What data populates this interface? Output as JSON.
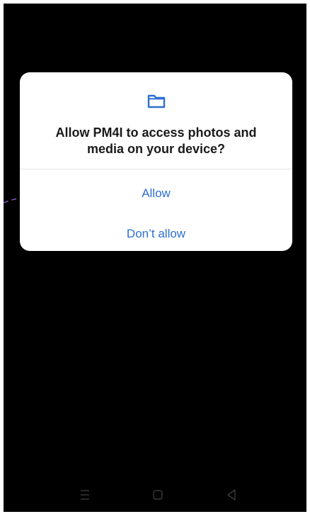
{
  "dialog": {
    "icon": "folder-icon",
    "title": "Allow PM4I to access photos and media on your device?",
    "allow_label": "Allow",
    "deny_label": "Don’t allow"
  },
  "navigation_bar": {
    "icons": [
      "menu-icon",
      "home-icon",
      "back-icon"
    ]
  },
  "colors": {
    "screen_background": "#000000",
    "dialog_background": "#ffffff",
    "title_text": "#1a1a1a",
    "action_text": "#2d6fd0",
    "guide_line": "#7d55b8",
    "nav_icon": "#3a3a3a"
  }
}
